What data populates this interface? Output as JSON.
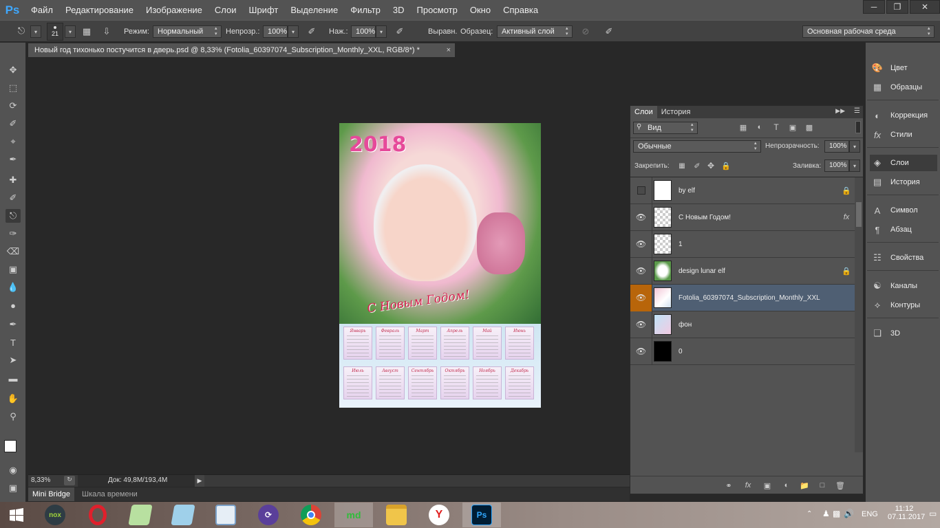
{
  "app": {
    "logo": "Ps"
  },
  "menu": [
    "Файл",
    "Редактирование",
    "Изображение",
    "Слои",
    "Шрифт",
    "Выделение",
    "Фильтр",
    "3D",
    "Просмотр",
    "Окно",
    "Справка"
  ],
  "options": {
    "brush_size": "21",
    "mode_label": "Режим:",
    "mode_value": "Нормальный",
    "opacity_label": "Непрозр.:",
    "opacity_value": "100%",
    "pressure_label": "Наж.:",
    "pressure_value": "100%",
    "aligned_label": "Выравн.",
    "sample_label": "Образец:",
    "sample_value": "Активный слой",
    "workspace": "Основная рабочая среда"
  },
  "document": {
    "tab_title": "Новый год тихонько постучится в дверь.psd @ 8,33% (Fotolia_60397074_Subscription_Monthly_XXL, RGB/8*) *",
    "close": "×",
    "year_text": "2018",
    "greeting": "С Новым Годом!",
    "months_row1": [
      "Январь",
      "Февраль",
      "Март",
      "Апрель",
      "Май",
      "Июнь"
    ],
    "months_row2": [
      "Июль",
      "Август",
      "Сентябрь",
      "Октябрь",
      "Ноябрь",
      "Декабрь"
    ]
  },
  "status": {
    "zoom": "8,33%",
    "doc_size": "Док: 49,8M/193,4M"
  },
  "bottom_tabs": [
    "Mini Bridge",
    "Шкала времени"
  ],
  "layers_panel": {
    "tabs": [
      "Слои",
      "История"
    ],
    "filter_kind": "Вид",
    "blend_mode": "Обычные",
    "opacity_label": "Непрозрачность:",
    "opacity_value": "100%",
    "lock_label": "Закрепить:",
    "fill_label": "Заливка:",
    "fill_value": "100%",
    "layers": [
      {
        "name": "by elf",
        "visible": false,
        "locked": true,
        "fx": false
      },
      {
        "name": "С Новым Годом!",
        "visible": true,
        "locked": false,
        "fx": true
      },
      {
        "name": "1",
        "visible": true,
        "locked": false,
        "fx": false
      },
      {
        "name": "design lunar elf",
        "visible": true,
        "locked": true,
        "fx": false
      },
      {
        "name": "Fotolia_60397074_Subscription_Monthly_XXL",
        "visible": true,
        "locked": false,
        "fx": false,
        "selected": true
      },
      {
        "name": "фон",
        "visible": true,
        "locked": false,
        "fx": false
      },
      {
        "name": "0",
        "visible": true,
        "locked": false,
        "fx": false
      }
    ],
    "fx_symbol": "fx"
  },
  "right_dock": [
    {
      "label": "Цвет",
      "icon": "palette-icon"
    },
    {
      "label": "Образцы",
      "icon": "swatches-icon"
    },
    {
      "label": "Коррекция",
      "icon": "adjustments-icon"
    },
    {
      "label": "Стили",
      "icon": "styles-icon"
    },
    {
      "label": "Слои",
      "icon": "layers-icon"
    },
    {
      "label": "История",
      "icon": "history-icon"
    },
    {
      "label": "Символ",
      "icon": "character-icon"
    },
    {
      "label": "Абзац",
      "icon": "paragraph-icon"
    },
    {
      "label": "Свойства",
      "icon": "properties-icon"
    },
    {
      "label": "Каналы",
      "icon": "channels-icon"
    },
    {
      "label": "Контуры",
      "icon": "paths-icon"
    },
    {
      "label": "3D",
      "icon": "3d-icon"
    }
  ],
  "taskbar": {
    "apps": [
      "nox",
      "Opera",
      "Notepad",
      "Editor",
      "Monitor",
      "Torrent",
      "Chrome",
      "md",
      "Explorer",
      "Yandex",
      "Ps"
    ],
    "nox_label": "nox",
    "ps_label": "Ps",
    "md_label": "md",
    "lang": "ENG",
    "time": "11:12",
    "date": "07.11.2017"
  },
  "colors": {
    "accent": "#3fa8ff",
    "selected_layer": "#4f5f73",
    "panel": "#535353"
  }
}
